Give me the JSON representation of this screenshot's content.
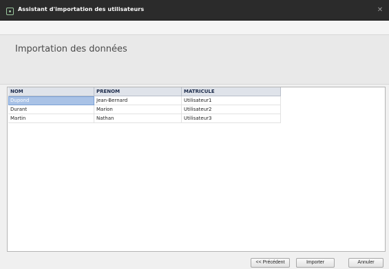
{
  "window": {
    "title": "Assistant d'importation des utilisateurs",
    "close_glyph": "✕",
    "icon": "app-icon"
  },
  "header": {
    "heading": "Importation des données"
  },
  "table": {
    "columns": [
      "NOM",
      "PRENOM",
      "MATRICULE"
    ],
    "rows": [
      [
        "Dupond",
        "Jean-Bernard",
        "Utilisateur1"
      ],
      [
        "Durant",
        "Marion",
        "Utilisateur2"
      ],
      [
        "Martin",
        "Nathan",
        "Utilisateur3"
      ]
    ],
    "selected_row": 0
  },
  "footer": {
    "prev_label": "<< Précédent",
    "import_label": "Importer",
    "cancel_label": "Annuler"
  }
}
